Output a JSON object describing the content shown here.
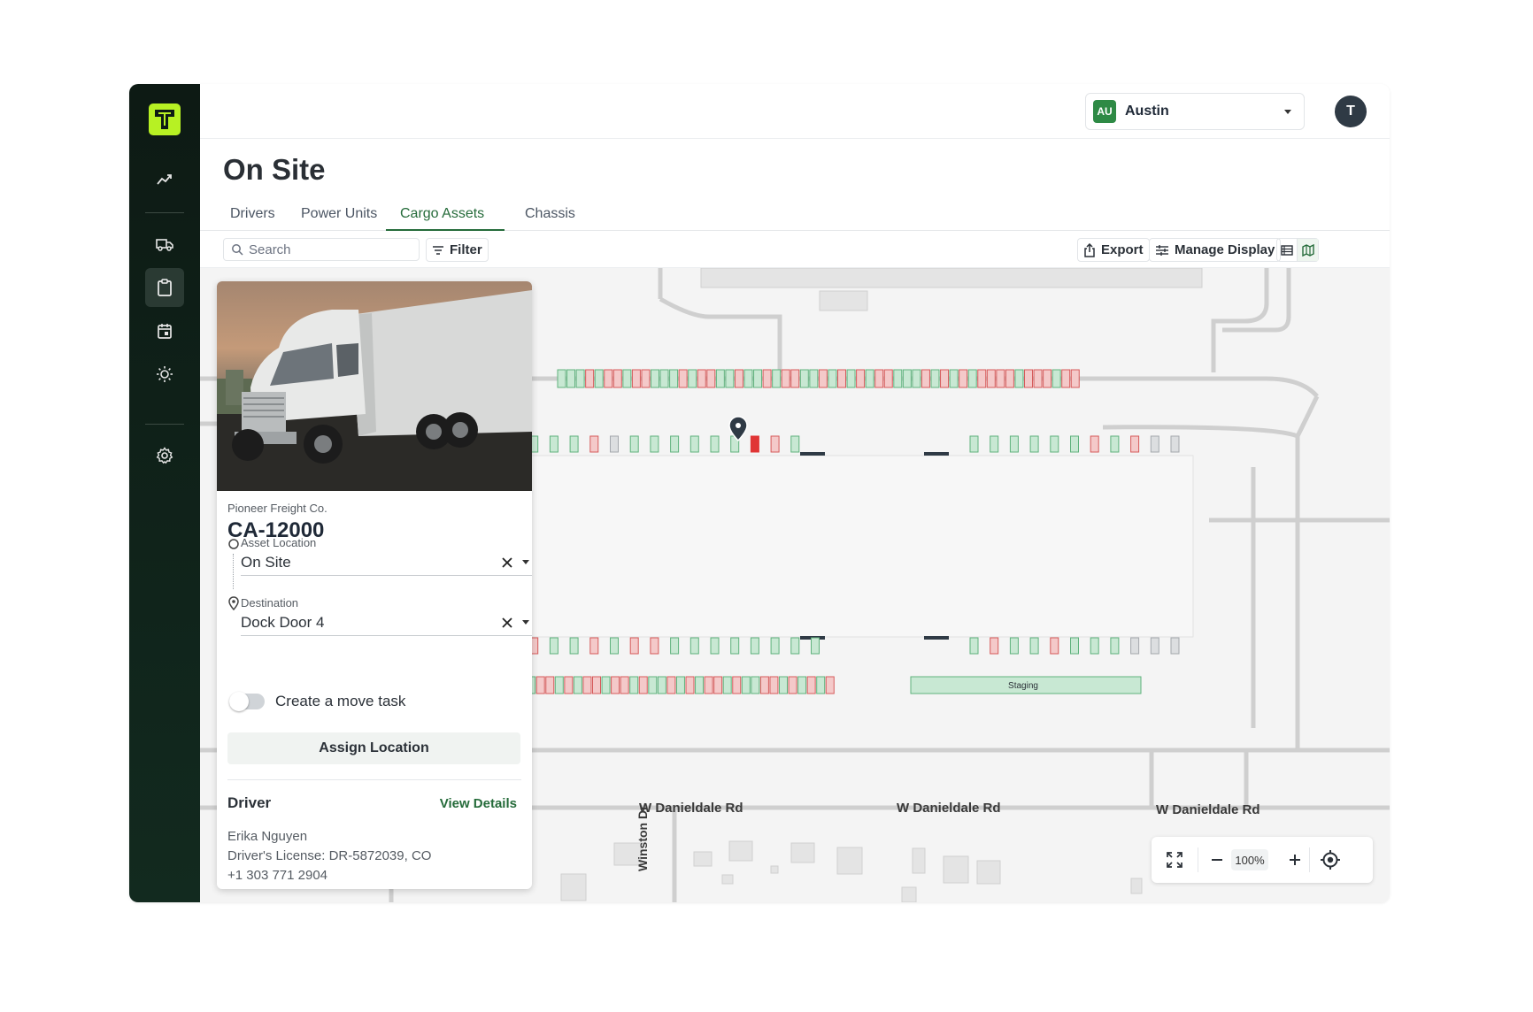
{
  "page": {
    "title": "On Site"
  },
  "header": {
    "location": {
      "code": "AU",
      "name": "Austin"
    },
    "user_initial": "T"
  },
  "sidebar": {
    "items": [
      {
        "icon": "analytics-icon"
      },
      {
        "icon": "truck-icon"
      },
      {
        "icon": "clipboard-icon",
        "active": true
      },
      {
        "icon": "calendar-icon"
      },
      {
        "icon": "brightness-icon"
      },
      {
        "icon": "gear-icon"
      }
    ]
  },
  "tabs": [
    {
      "label": "Drivers"
    },
    {
      "label": "Power Units"
    },
    {
      "label": "Cargo Assets",
      "active": true
    },
    {
      "label": "Chassis"
    }
  ],
  "toolbar": {
    "search_placeholder": "Search",
    "filter_label": "Filter",
    "export_label": "Export",
    "manage_display_label": "Manage Display"
  },
  "card": {
    "carrier": "Pioneer Freight Co.",
    "asset_id": "CA-12000",
    "asset_location_label": "Asset Location",
    "asset_location_value": "On Site",
    "destination_label": "Destination",
    "destination_value": "Dock Door 4",
    "move_task_label": "Create a move task",
    "assign_label": "Assign Location",
    "driver_heading": "Driver",
    "view_details": "View Details",
    "driver_name": "Erika Nguyen",
    "driver_license": "Driver's License: DR-5872039, CO",
    "driver_phone": "+1 303 771 2904"
  },
  "map": {
    "staging_label": "Staging",
    "street_top": "W Danieldale Rd",
    "street_side": "Winston Dr",
    "zoom": "100%",
    "colors": {
      "green": "#c8e8d3",
      "green_stroke": "#5fb27d",
      "red": "#f4c9c9",
      "red_stroke": "#d65a5a",
      "gray": "#dcdee0",
      "gray_stroke": "#a4a8ad",
      "selected": "#e03535"
    }
  }
}
